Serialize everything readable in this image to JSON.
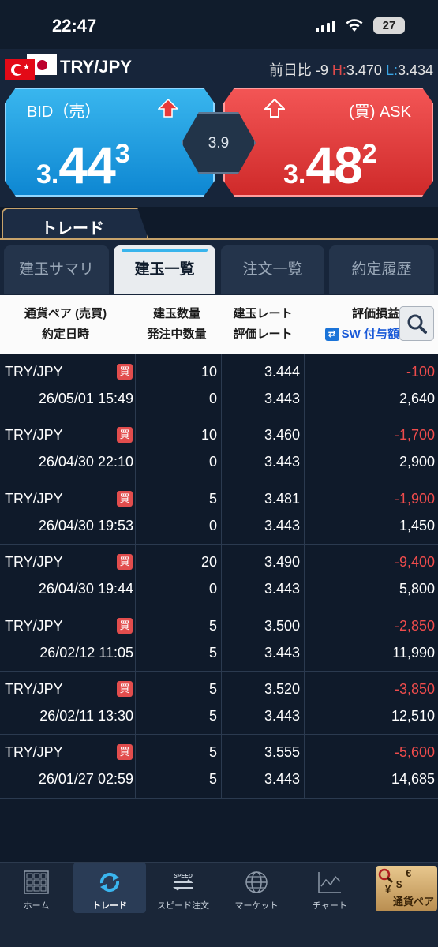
{
  "status_bar": {
    "time": "22:47",
    "battery": "27"
  },
  "pair_header": {
    "pair": "TRY/JPY",
    "change_label": "前日比",
    "change_value": "-9",
    "high_label": "H:",
    "high_value": "3.470",
    "low_label": "L:",
    "low_value": "3.434"
  },
  "bid": {
    "label": "BID（売）",
    "small": "3.",
    "big": "44",
    "tail": "3"
  },
  "ask": {
    "label": "(買) ASK",
    "small": "3.",
    "big": "48",
    "tail": "2"
  },
  "spread": "3.9",
  "main_tab": "トレード",
  "sub_tabs": [
    "建玉サマリ",
    "建玉一覧",
    "注文一覧",
    "約定履歴"
  ],
  "columns": {
    "c1_line1": "通貨ペア (売買)",
    "c1_line2": "約定日時",
    "c2_line1": "建玉数量",
    "c2_line2": "発注中数量",
    "c3_line1": "建玉レート",
    "c3_line2": "評価レート",
    "c4_line1": "評価損益",
    "c4_line2": "SW 付与額"
  },
  "buy_badge": "買",
  "positions": [
    {
      "pair": "TRY/JPY",
      "date": "26/05/01 15:49",
      "qty": "10",
      "pending": "0",
      "rate": "3.444",
      "eval_rate": "3.443",
      "pl": "-100",
      "sw": "2,640"
    },
    {
      "pair": "TRY/JPY",
      "date": "26/04/30 22:10",
      "qty": "10",
      "pending": "0",
      "rate": "3.460",
      "eval_rate": "3.443",
      "pl": "-1,700",
      "sw": "2,900"
    },
    {
      "pair": "TRY/JPY",
      "date": "26/04/30 19:53",
      "qty": "5",
      "pending": "0",
      "rate": "3.481",
      "eval_rate": "3.443",
      "pl": "-1,900",
      "sw": "1,450"
    },
    {
      "pair": "TRY/JPY",
      "date": "26/04/30 19:44",
      "qty": "20",
      "pending": "0",
      "rate": "3.490",
      "eval_rate": "3.443",
      "pl": "-9,400",
      "sw": "5,800"
    },
    {
      "pair": "TRY/JPY",
      "date": "26/02/12 11:05",
      "qty": "5",
      "pending": "5",
      "rate": "3.500",
      "eval_rate": "3.443",
      "pl": "-2,850",
      "sw": "11,990"
    },
    {
      "pair": "TRY/JPY",
      "date": "26/02/11 13:30",
      "qty": "5",
      "pending": "5",
      "rate": "3.520",
      "eval_rate": "3.443",
      "pl": "-3,850",
      "sw": "12,510"
    },
    {
      "pair": "TRY/JPY",
      "date": "26/01/27 02:59",
      "qty": "5",
      "pending": "5",
      "rate": "3.555",
      "eval_rate": "3.443",
      "pl": "-5,600",
      "sw": "14,685"
    }
  ],
  "nav": {
    "home": "ホーム",
    "trade": "トレード",
    "speed": "スピード注文",
    "speed_icon_text": "SPEED",
    "market": "マーケット",
    "chart": "チャート",
    "currency": "通貨ペア"
  }
}
